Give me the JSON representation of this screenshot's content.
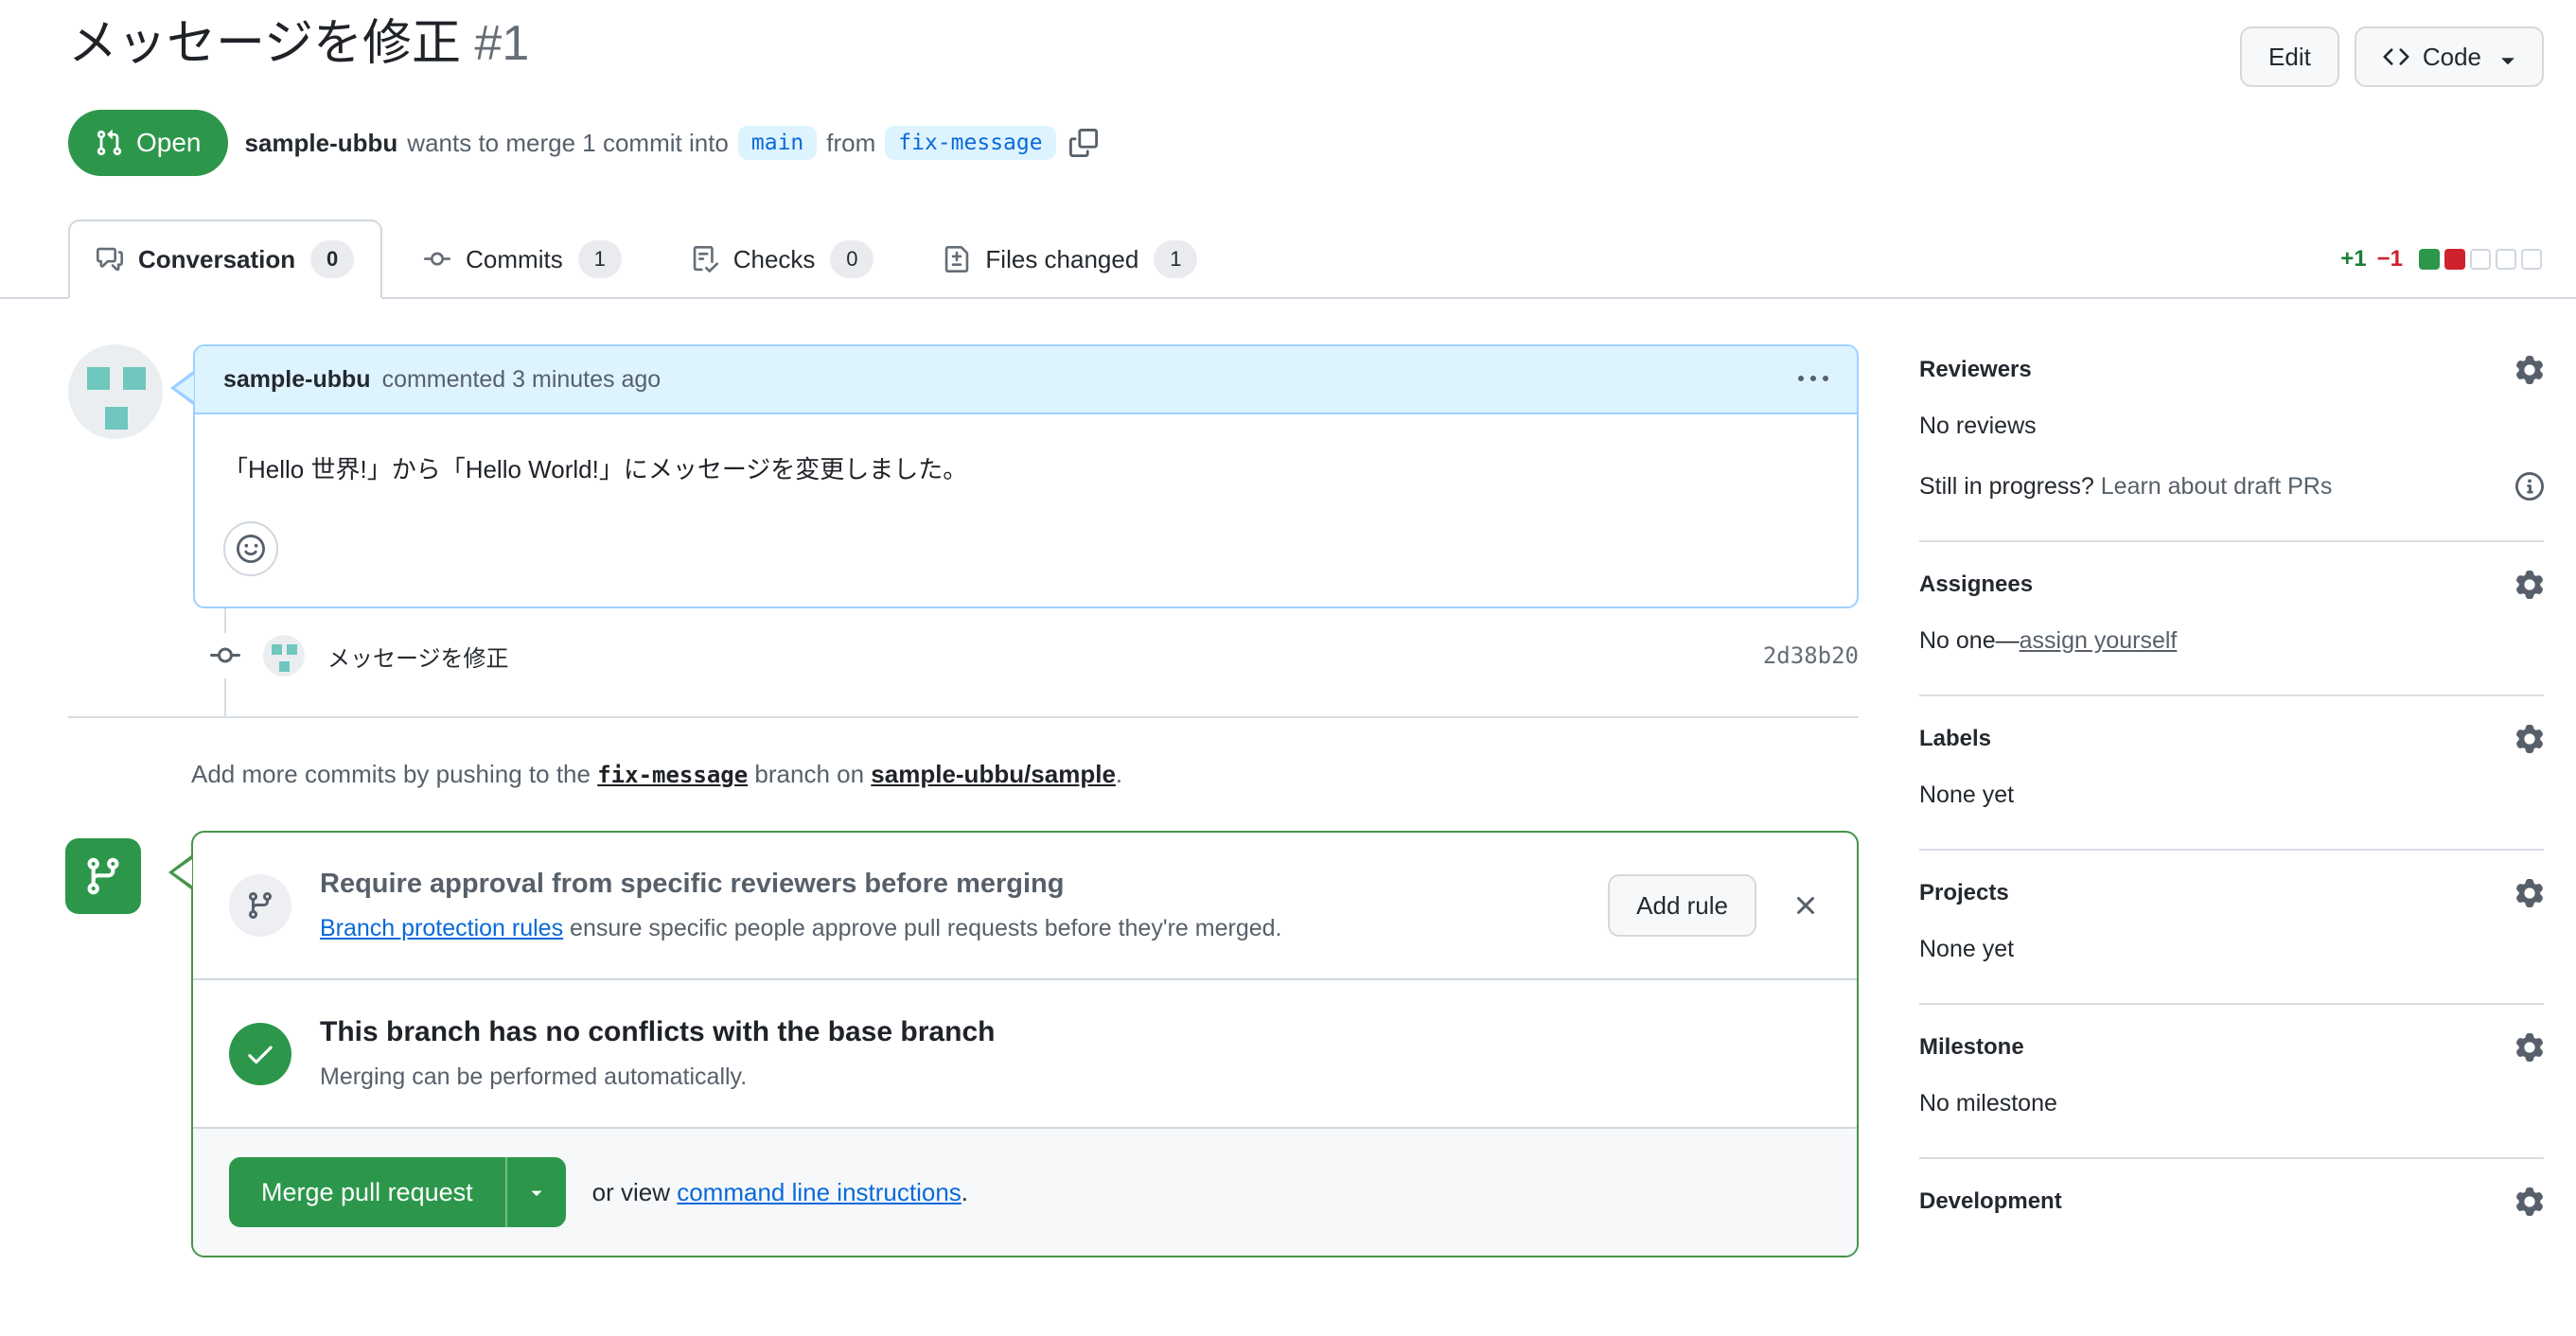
{
  "page": {
    "title": "メッセージを修正",
    "number": "#1"
  },
  "header": {
    "edit_button": "Edit",
    "code_button": "Code",
    "status_badge": "Open",
    "meta": {
      "author": "sample-ubbu",
      "text_before_base": "wants to merge 1 commit into",
      "base_branch": "main",
      "text_between": "from",
      "head_branch": "fix-message"
    }
  },
  "tabs": [
    {
      "label": "Conversation",
      "count": "0"
    },
    {
      "label": "Commits",
      "count": "1"
    },
    {
      "label": "Checks",
      "count": "0"
    },
    {
      "label": "Files changed",
      "count": "1"
    }
  ],
  "diffstat": {
    "additions": "+1",
    "deletions": "−1"
  },
  "conversation": {
    "comment": {
      "author": "sample-ubbu",
      "meta": "commented 3 minutes ago",
      "body": "「Hello 世界!」から「Hello World!」にメッセージを変更しました。"
    },
    "commit": {
      "message": "メッセージを修正",
      "sha": "2d38b20"
    },
    "add_commits": {
      "before": "Add more commits by pushing to the",
      "branch": "fix-message",
      "middle": "branch on",
      "repo": "sample-ubbu/sample",
      "after": "."
    }
  },
  "merge_box": {
    "protection": {
      "title": "Require approval from specific reviewers before merging",
      "link": "Branch protection rules",
      "description": "ensure specific people approve pull requests before they're merged.",
      "add_rule_button": "Add rule"
    },
    "mergeability": {
      "title": "This branch has no conflicts with the base branch",
      "subtitle": "Merging can be performed automatically."
    },
    "actions": {
      "merge_button": "Merge pull request",
      "or_view": "or view",
      "cli_link": "command line instructions",
      "period": "."
    }
  },
  "sidebar": {
    "reviewers": {
      "title": "Reviewers",
      "empty": "No reviews",
      "draft_hint": "Still in progress?",
      "draft_link": "Learn about draft PRs"
    },
    "assignees": {
      "title": "Assignees",
      "empty": "No one—",
      "self_assign": "assign yourself"
    },
    "labels": {
      "title": "Labels",
      "empty": "None yet"
    },
    "projects": {
      "title": "Projects",
      "empty": "None yet"
    },
    "milestone": {
      "title": "Milestone",
      "empty": "No milestone"
    },
    "development": {
      "title": "Development"
    }
  },
  "colors": {
    "open_green": "#2c974b",
    "merge_box_border_green": "#46954a",
    "link_blue": "#0969da",
    "branch_label_bg": "#ddf4ff",
    "comment_header_bg": "#ddf4ff",
    "additions_green": "#1a7f37",
    "deletions_red": "#cf222e",
    "identicon_teal": "#6fc7bd"
  }
}
